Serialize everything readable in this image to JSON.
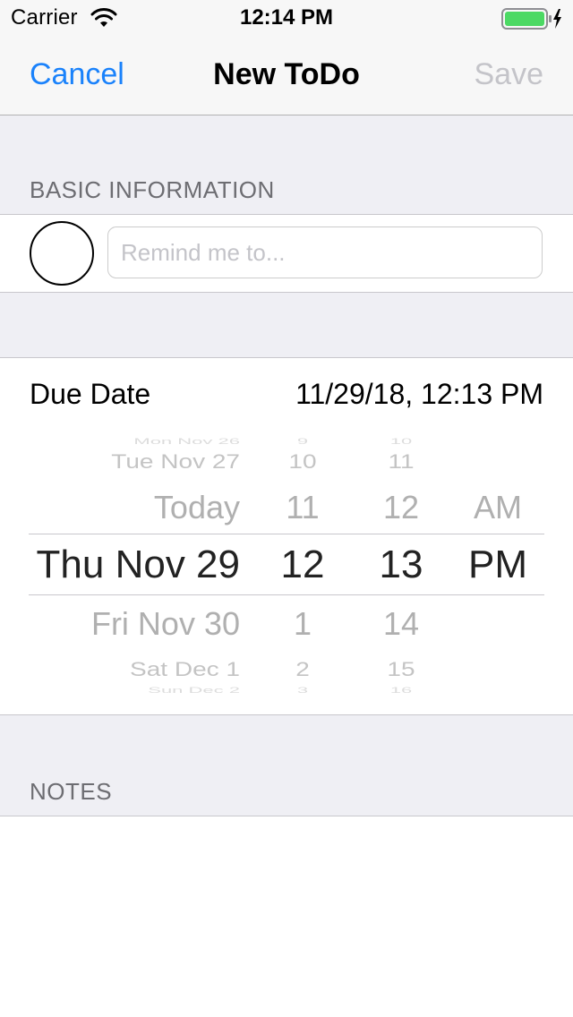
{
  "status_bar": {
    "carrier": "Carrier",
    "time": "12:14 PM",
    "battery_color": "#4cd964"
  },
  "nav": {
    "cancel_label": "Cancel",
    "title": "New ToDo",
    "save_label": "Save",
    "accent_color": "#1a82fb",
    "disabled_color": "#c4c4c9"
  },
  "basic_info": {
    "header": "BASIC INFORMATION",
    "reminder_placeholder": "Remind me to...",
    "reminder_value": ""
  },
  "due_date": {
    "label": "Due Date",
    "value": "11/29/18, 12:13 PM"
  },
  "picker": {
    "dates": {
      "above3": "Mon Nov 26",
      "above2": "Tue Nov 27",
      "above1": "Today",
      "selected": "Thu Nov 29",
      "below1": "Fri Nov 30",
      "below2": "Sat Dec 1",
      "below3": "Sun Dec 2"
    },
    "hours": {
      "above3": "9",
      "above2": "10",
      "above1": "11",
      "selected": "12",
      "below1": "1",
      "below2": "2",
      "below3": "3"
    },
    "minutes": {
      "above3": "10",
      "above2": "11",
      "above1": "12",
      "selected": "13",
      "below1": "14",
      "below2": "15",
      "below3": "16"
    },
    "ampm": {
      "above1": "AM",
      "selected": "PM"
    }
  },
  "notes": {
    "header": "NOTES"
  }
}
